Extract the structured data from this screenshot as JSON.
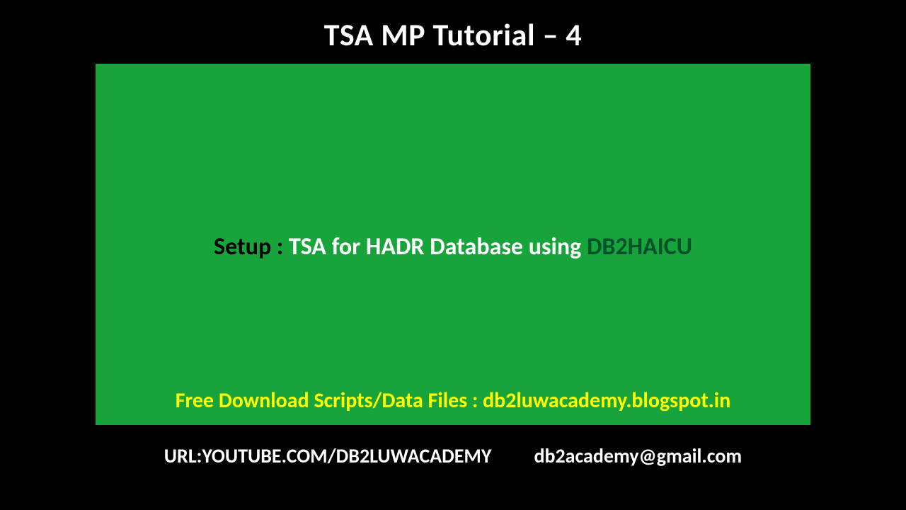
{
  "title": "TSA MP Tutorial – 4",
  "setup": {
    "label": "Setup : ",
    "main": "TSA for HADR Database using ",
    "tool": "DB2HAICU"
  },
  "download": "Free Download Scripts/Data Files : db2luwacademy.blogspot.in",
  "footer": {
    "url": "URL:YOUTUBE.COM/DB2LUWACADEMY",
    "email": "db2academy@gmail.com"
  },
  "colors": {
    "background": "#000000",
    "panel": "#17a43b",
    "title": "#ffffff",
    "accent": "#ffff00",
    "tool": "#00502a"
  }
}
